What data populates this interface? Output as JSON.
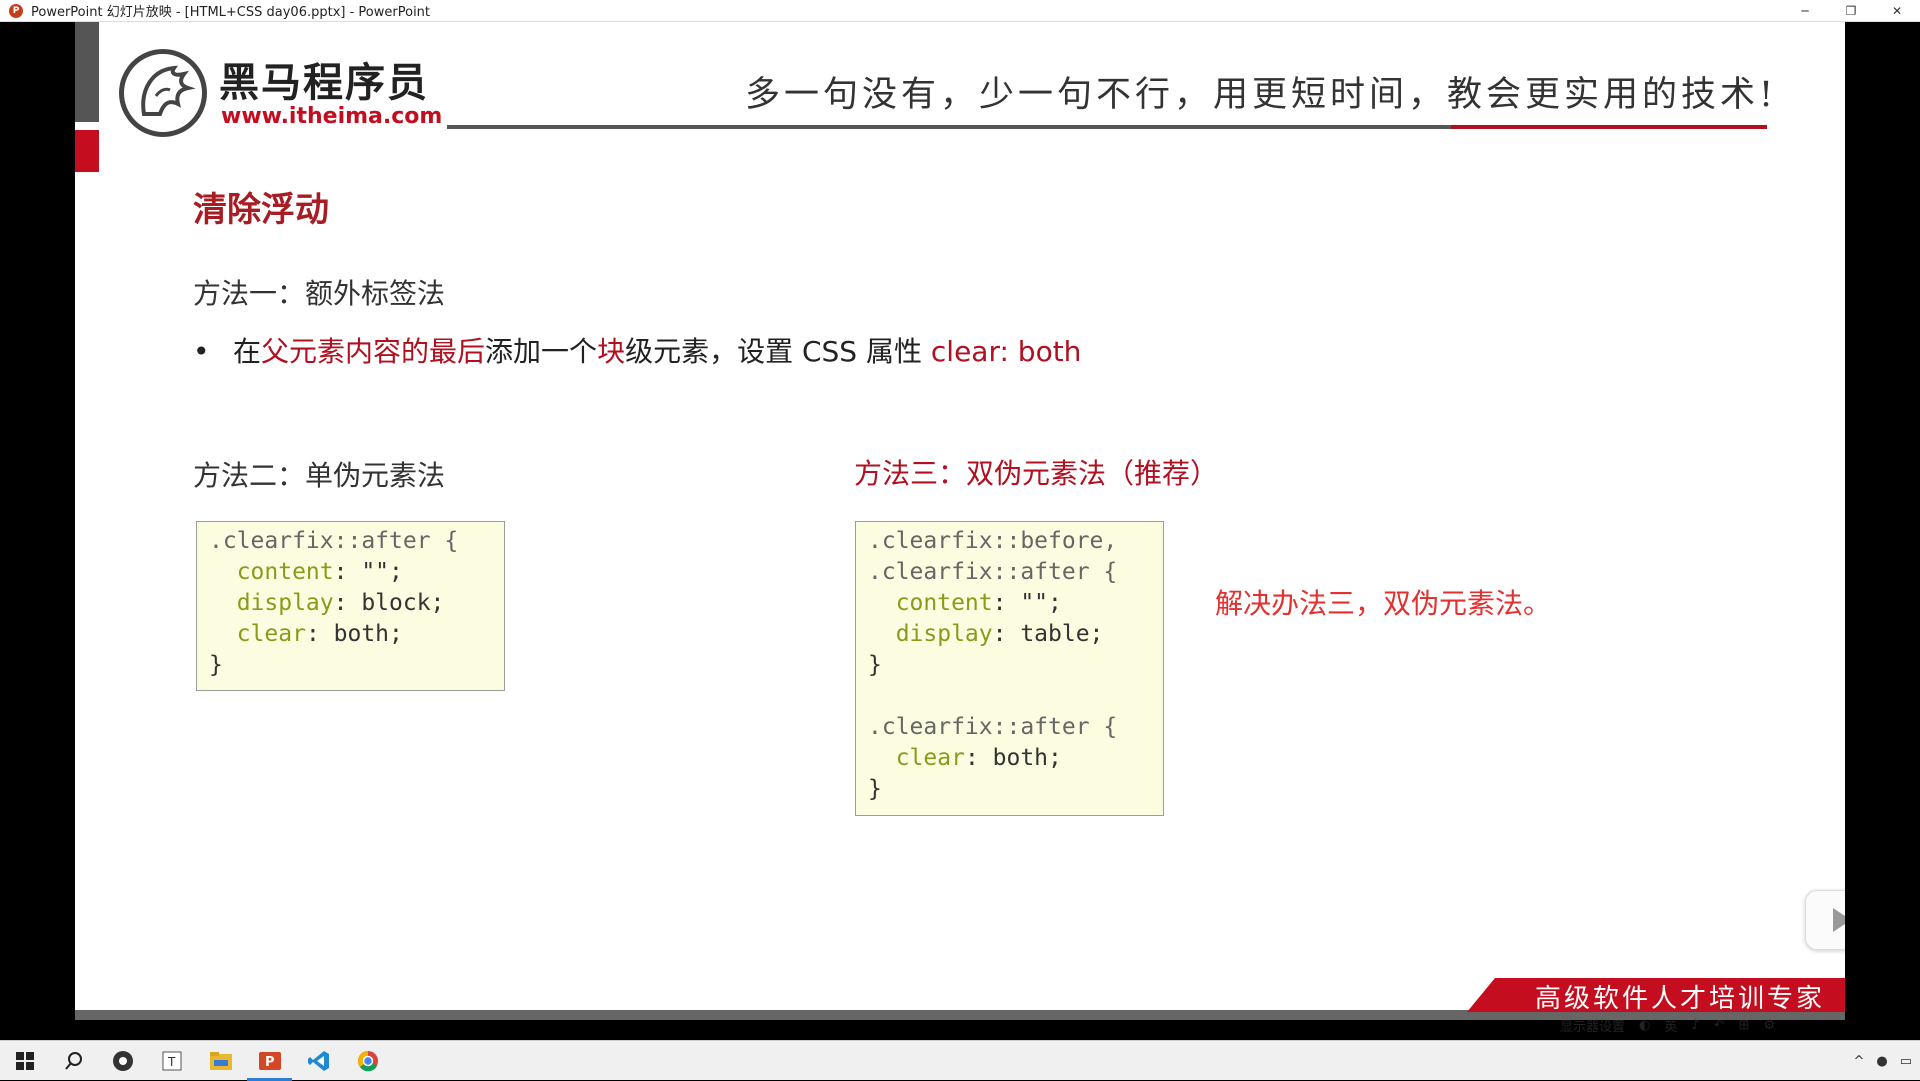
{
  "window": {
    "title": "PowerPoint 幻灯片放映 - [HTML+CSS day06.pptx] - PowerPoint",
    "controls": [
      "─",
      "❐",
      "✕"
    ]
  },
  "slide": {
    "logo": {
      "name": "黑马程序员",
      "url": "www.itheima.com"
    },
    "slogan": "多一句没有，少一句不行，用更短时间，教会更实用的技术!",
    "title": "清除浮动",
    "method1": {
      "heading": "方法一：额外标签法",
      "bullet": "•",
      "segments": [
        {
          "text": "在",
          "red": false
        },
        {
          "text": "父元素",
          "red": true
        },
        {
          "text": "内容的最后",
          "red": true
        },
        {
          "text": "添加一个",
          "red": false
        },
        {
          "text": "块",
          "red": true
        },
        {
          "text": "级元素，设置 CSS 属性 ",
          "red": false
        },
        {
          "text": "clear: both",
          "red": true
        }
      ]
    },
    "method2": {
      "heading": "方法二：单伪元素法",
      "code": [
        [
          {
            "t": ".clearfix::after {",
            "c": "sel"
          }
        ],
        [
          {
            "t": "  content",
            "c": "prop"
          },
          {
            "t": ": \"\";",
            "c": ""
          }
        ],
        [
          {
            "t": "  display",
            "c": "prop"
          },
          {
            "t": ": block;",
            "c": ""
          }
        ],
        [
          {
            "t": "  clear",
            "c": "prop"
          },
          {
            "t": ": both;",
            "c": ""
          }
        ],
        [
          {
            "t": "}",
            "c": ""
          }
        ]
      ]
    },
    "method3": {
      "heading": "方法三：双伪元素法（推荐）",
      "code": [
        [
          {
            "t": ".clearfix::before,",
            "c": "sel"
          }
        ],
        [
          {
            "t": ".clearfix::after {",
            "c": "sel"
          }
        ],
        [
          {
            "t": "  content",
            "c": "prop"
          },
          {
            "t": ": \"\";",
            "c": ""
          }
        ],
        [
          {
            "t": "  display",
            "c": "prop"
          },
          {
            "t": ": table;",
            "c": ""
          }
        ],
        [
          {
            "t": "}",
            "c": ""
          }
        ],
        [
          {
            "t": "",
            "c": ""
          }
        ],
        [
          {
            "t": ".clearfix::after {",
            "c": "sel"
          }
        ],
        [
          {
            "t": "  clear",
            "c": "prop"
          },
          {
            "t": ": both;",
            "c": ""
          }
        ],
        [
          {
            "t": "}",
            "c": ""
          }
        ]
      ]
    },
    "note": "解决办法三，双伪元素法。",
    "footer": "高级软件人才培训专家"
  },
  "presenter_toolbar": [
    "显示器设置",
    "◐",
    "英",
    "♪",
    "↶",
    "⊞",
    "⚙"
  ],
  "taskbar": {
    "items": [
      "start-icon",
      "search-icon",
      "obs-icon",
      "typora-icon",
      "file-explorer-icon",
      "powerpoint-icon",
      "vscode-icon",
      "chrome-icon"
    ],
    "tray": [
      "^",
      "●",
      "▭"
    ]
  },
  "colors": {
    "brand_red": "#c40d1e",
    "title_red": "#a81c24",
    "note_red": "#e53030",
    "code_bg": "#fcfce0",
    "prop_color": "#8a9a1a"
  }
}
